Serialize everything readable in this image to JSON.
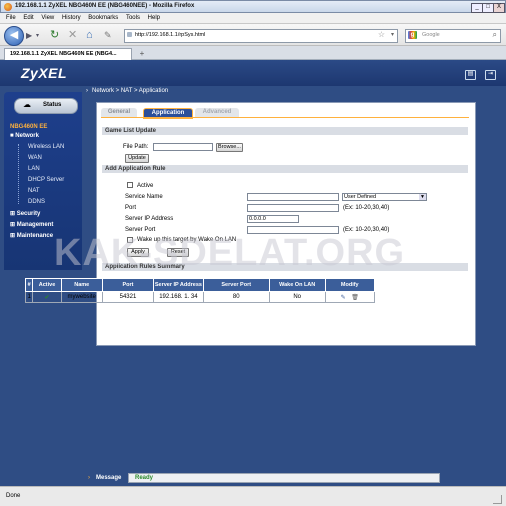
{
  "window": {
    "title": "192.168.1.1 ZyXEL NBG460N EE (NBG460NEE) - Mozilla Firefox",
    "controls": [
      "_",
      "□",
      "X"
    ]
  },
  "menu": [
    "File",
    "Edit",
    "View",
    "History",
    "Bookmarks",
    "Tools",
    "Help"
  ],
  "browser": {
    "url": "http://192.168.1.1/rpSys.html",
    "search_placeholder": "Google",
    "tab_title": "192.168.1.1 ZyXEL NBG460N EE (NBG4...",
    "tab_add": "+"
  },
  "app": {
    "logo": "ZyXEL",
    "breadcrumb": "Network > NAT > Application"
  },
  "nav": {
    "status_label": "Status",
    "device": "NBG460N EE",
    "network": "Network",
    "items": [
      "Wireless LAN",
      "WAN",
      "LAN",
      "DHCP Server",
      "NAT",
      "DDNS"
    ],
    "security": "Security",
    "management": "Management",
    "maintenance": "Maintenance"
  },
  "tabs": [
    "General",
    "Application",
    "Advanced"
  ],
  "game_list": {
    "header": "Game List Update",
    "file_path_label": "File Path:",
    "file_path_value": "",
    "browse": "Browse...",
    "update": "Update"
  },
  "add_rule": {
    "header": "Add Application Rule",
    "active_label": "Active",
    "service_name_label": "Service Name",
    "service_name_value": "",
    "service_select": "User Defined",
    "port_label": "Port",
    "port_value": "",
    "port_hint": "(Ex: 10-20,30,40)",
    "server_ip_label": "Server IP Address",
    "server_ip_value": "0.0.0.0",
    "server_port_label": "Server Port",
    "server_port_value": "",
    "server_port_hint": "(Ex: 10-20,30,40)",
    "wol_label": "Wake up this target by Wake On LAN",
    "apply": "Apply",
    "reset": "Reset"
  },
  "summary": {
    "header": "Application Rules Summary",
    "columns": [
      "#",
      "Active",
      "Name",
      "Port",
      "Server IP Address",
      "Server Port",
      "Wake On LAN",
      "Modify"
    ],
    "rows": [
      {
        "num": "1",
        "active": "✔",
        "name": "mywebsite",
        "port": "54321",
        "server_ip": "192.168. 1. 34",
        "server_port": "80",
        "wol": "No"
      }
    ]
  },
  "message": {
    "label": "Message",
    "text": "Ready"
  },
  "statusbar": "Done",
  "watermark": "KAK-SDELAT.ORG",
  "colors": {
    "page_bg": "#2f4d84",
    "nav_bg": "#1e3f8c",
    "accent": "#ffb13d",
    "table_header": "#3b5e9a",
    "active_tab": "#2c4f9a"
  }
}
